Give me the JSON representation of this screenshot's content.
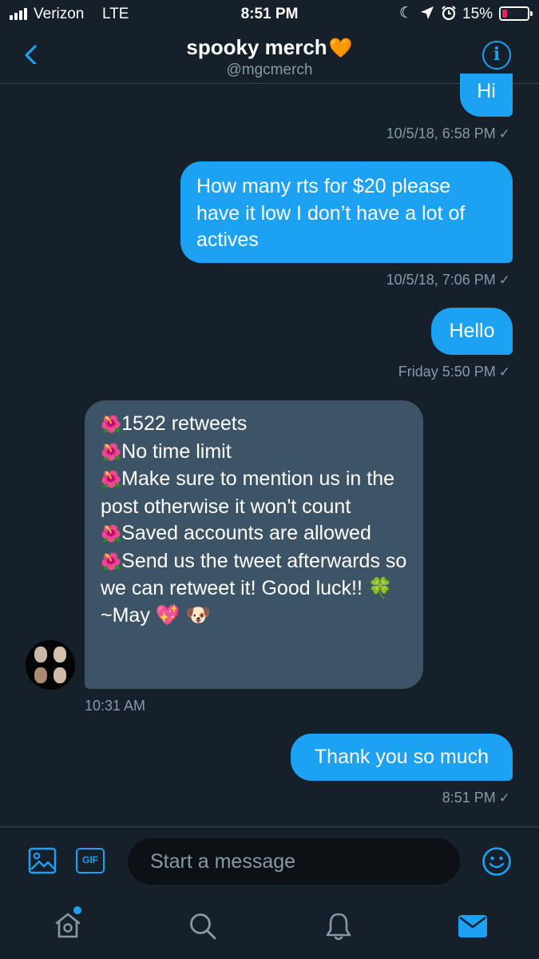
{
  "status_bar": {
    "carrier": "Verizon",
    "network": "LTE",
    "time": "8:51 PM",
    "battery": "15%",
    "battery_level": 0.15,
    "icons": [
      "signal-icon",
      "moon-icon",
      "location-arrow-icon",
      "alarm-icon",
      "battery-icon"
    ]
  },
  "header": {
    "title": "spooky merch",
    "title_emoji": "🧡",
    "handle": "@mgcmerch",
    "back_icon": "chevron-left-icon",
    "info_icon": "info-icon",
    "info_glyph": "i"
  },
  "messages": [
    {
      "direction": "outgoing",
      "text": "Hi",
      "timestamp": ""
    },
    {
      "direction": "outgoing",
      "text": "How many rts for $20 please have it low I don’t have a lot of actives",
      "timestamp": "10/5/18, 6:58 PM"
    },
    {
      "direction": "outgoing",
      "text": "Hello",
      "timestamp": "10/5/18, 7:06 PM"
    },
    {
      "direction": "incoming",
      "bullet": "🌺",
      "lines": [
        "1522 retweets",
        "No time limit",
        "Make sure to mention us in the post otherwise it won't count",
        "Saved accounts are allowed",
        "Send us the tweet afterwards so we can retweet it! Good luck!! 🍀",
        "~May 💖 🐶"
      ],
      "timestamp": "Friday 5:50 PM"
    },
    {
      "direction": "outgoing",
      "text": "Thank you so much",
      "timestamp": "10:31 AM"
    }
  ],
  "last_timestamp": "8:51 PM",
  "read_mark": "✓",
  "composer": {
    "placeholder": "Start a message",
    "gif_label": "GIF",
    "icons": [
      "image-icon",
      "gif-icon",
      "emoji-icon"
    ]
  },
  "tab_bar": {
    "items": [
      "home-icon",
      "search-icon",
      "notifications-icon",
      "messages-icon"
    ],
    "active": "messages-icon"
  },
  "colors": {
    "background": "#15202b",
    "accent": "#1da1f2",
    "incoming_bubble": "#3d5466",
    "muted_text": "#8899a6",
    "divider": "#38444d",
    "battery_low": "#e0245e"
  }
}
